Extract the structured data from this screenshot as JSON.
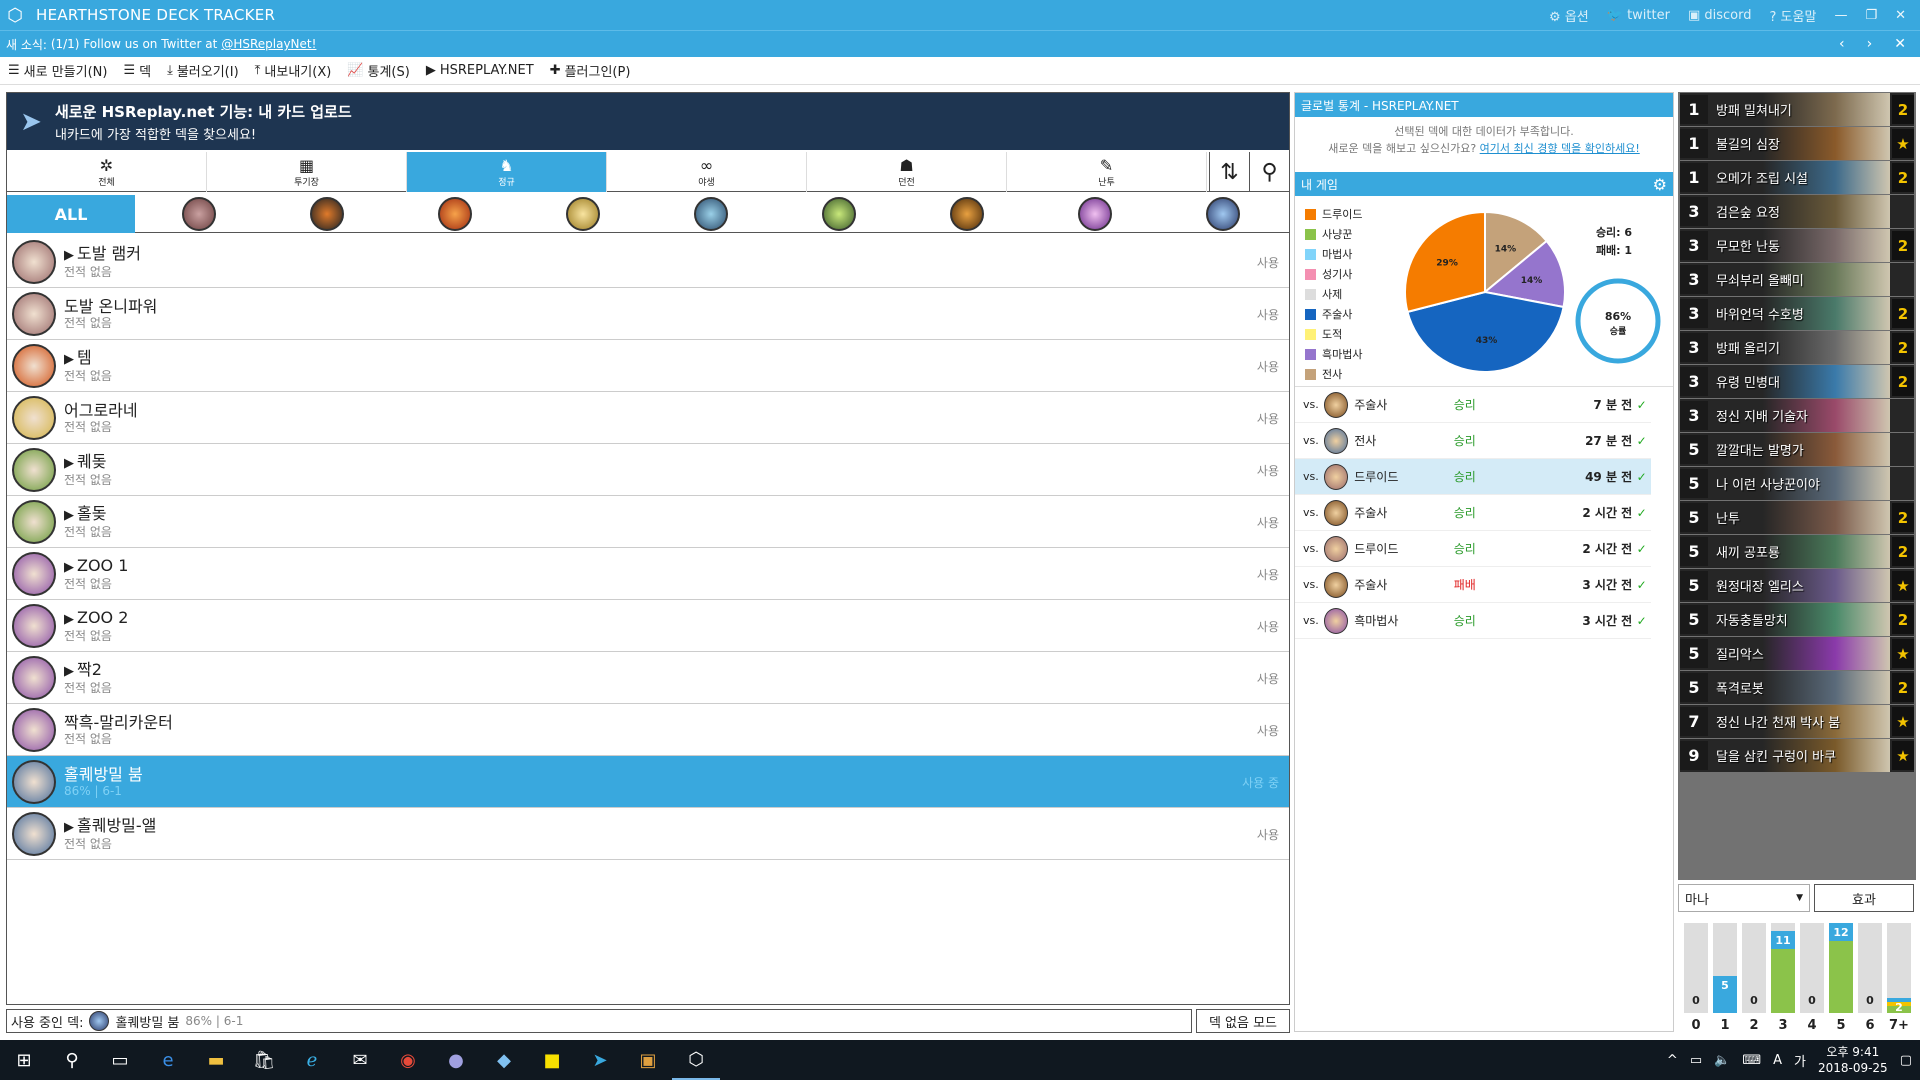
{
  "titlebar": {
    "title": "HEARTHSTONE DECK TRACKER",
    "options": "옵션",
    "twitter": "twitter",
    "discord": "discord",
    "help": "도움말"
  },
  "news": {
    "label": "새 소식:",
    "count": "(1/1)",
    "text": "Follow us on Twitter at",
    "link": "@HSReplayNet!"
  },
  "menu": {
    "new": "새로 만들기(N)",
    "deck": "덱",
    "import": "불러오기(I)",
    "export": "내보내기(X)",
    "stats": "통계(S)",
    "hsreplay": "HSREPLAY.NET",
    "plugins": "플러그인(P)"
  },
  "banner": {
    "title": "새로운 HSReplay.net 기능: 내 카드 업로드",
    "subtitle": "내카드에 가장 적합한 덱을 찾으세요!"
  },
  "modetabs": [
    {
      "label": "전체",
      "icon": "gear-icon"
    },
    {
      "label": "투기장",
      "icon": "arena-icon"
    },
    {
      "label": "정규",
      "icon": "standard-icon"
    },
    {
      "label": "야생",
      "icon": "wild-icon"
    },
    {
      "label": "던전",
      "icon": "dungeon-icon"
    },
    {
      "label": "난투",
      "icon": "brawl-icon"
    }
  ],
  "classtabs": {
    "all": "ALL"
  },
  "decks": [
    {
      "name": "도발 램커",
      "sub": "전적 없음",
      "use": "사용",
      "hs": true,
      "color": "#9a6b6b"
    },
    {
      "name": "도발 온니파워",
      "sub": "전적 없음",
      "use": "사용",
      "hs": false,
      "color": "#9a6b6b"
    },
    {
      "name": "템",
      "sub": "전적 없음",
      "use": "사용",
      "hs": true,
      "color": "#d2551b"
    },
    {
      "name": "어그로라네",
      "sub": "전적 없음",
      "use": "사용",
      "hs": false,
      "color": "#d4b448"
    },
    {
      "name": "퀘돚",
      "sub": "전적 없음",
      "use": "사용",
      "hs": true,
      "color": "#6a9b3a"
    },
    {
      "name": "홀돚",
      "sub": "전적 없음",
      "use": "사용",
      "hs": true,
      "color": "#6a9b3a"
    },
    {
      "name": "ZOO 1",
      "sub": "전적 없음",
      "use": "사용",
      "hs": true,
      "color": "#8b4fa6"
    },
    {
      "name": "ZOO 2",
      "sub": "전적 없음",
      "use": "사용",
      "hs": true,
      "color": "#8b4fa6"
    },
    {
      "name": "짝2",
      "sub": "전적 없음",
      "use": "사용",
      "hs": true,
      "color": "#8b4fa6"
    },
    {
      "name": "짝흑-말리카운터",
      "sub": "전적 없음",
      "use": "사용",
      "hs": false,
      "color": "#8b4fa6"
    },
    {
      "name": "홀퀘방밀 붐",
      "sub": "86% | 6-1",
      "use": "사용 중",
      "hs": false,
      "color": "#4c6f9c",
      "selected": true
    },
    {
      "name": "홀퀘방밀-앨",
      "sub": "전적 없음",
      "use": "사용",
      "hs": true,
      "color": "#4c6f9c"
    }
  ],
  "status": {
    "label": "사용 중인 덱:",
    "deck": "홀퀘방밀 붐",
    "record": "86% | 6-1",
    "nodeck": "덱 없음 모드"
  },
  "global": {
    "header": "글로벌 통계 - HSREPLAY.NET",
    "line1": "선택된 덱에 대한 데이터가 부족합니다.",
    "line2": "새로운 덱을 해보고 싶으신가요?",
    "link": "여기서 최신 경향 덱을 확인하세요!"
  },
  "mygame": {
    "header": "내 게임",
    "wins": "승리: 6",
    "losses": "패배: 1",
    "winrate": "86%",
    "winlabel": "승률"
  },
  "legend": [
    {
      "name": "드루이드",
      "color": "#f57c00"
    },
    {
      "name": "사냥꾼",
      "color": "#8bc34a"
    },
    {
      "name": "마법사",
      "color": "#81d4fa"
    },
    {
      "name": "성기사",
      "color": "#f48fb1"
    },
    {
      "name": "사제",
      "color": "#dddddd"
    },
    {
      "name": "주술사",
      "color": "#1565c0"
    },
    {
      "name": "도적",
      "color": "#fff176"
    },
    {
      "name": "흑마법사",
      "color": "#9575cd"
    },
    {
      "name": "전사",
      "color": "#c4a27a"
    }
  ],
  "chart_data": {
    "type": "pie",
    "slices": [
      {
        "label": "드루이드",
        "value": 29
      },
      {
        "label": "주술사",
        "value": 43
      },
      {
        "label": "흑마법사",
        "value": 14
      },
      {
        "label": "전사",
        "value": 14
      }
    ]
  },
  "games": [
    {
      "vs": "vs.",
      "class": "주술사",
      "result": "승리",
      "time": "7 분 전",
      "color": "#7a4b1e",
      "win": true
    },
    {
      "vs": "vs.",
      "class": "전사",
      "result": "승리",
      "time": "27 분 전",
      "color": "#4c6f9c",
      "win": true
    },
    {
      "vs": "vs.",
      "class": "드루이드",
      "result": "승리",
      "time": "49 분 전",
      "color": "#9a6b6b",
      "win": true,
      "selected": true
    },
    {
      "vs": "vs.",
      "class": "주술사",
      "result": "승리",
      "time": "2 시간 전",
      "color": "#7a4b1e",
      "win": true
    },
    {
      "vs": "vs.",
      "class": "드루이드",
      "result": "승리",
      "time": "2 시간 전",
      "color": "#9a6b6b",
      "win": true
    },
    {
      "vs": "vs.",
      "class": "주술사",
      "result": "패배",
      "time": "3 시간 전",
      "color": "#7a4b1e",
      "win": false
    },
    {
      "vs": "vs.",
      "class": "흑마법사",
      "result": "승리",
      "time": "3 시간 전",
      "color": "#8b4fa6",
      "win": true
    }
  ],
  "cards": [
    {
      "cost": "1",
      "name": "방패 밀쳐내기",
      "count": "2",
      "color": "#7d6a4e"
    },
    {
      "cost": "1",
      "name": "불길의 심장",
      "count": "★",
      "color": "#8a5a2a"
    },
    {
      "cost": "1",
      "name": "오메가 조립 시설",
      "count": "2",
      "color": "#3d6a8a"
    },
    {
      "cost": "3",
      "name": "검은숲 요정",
      "count": "",
      "color": "#6a5a3a"
    },
    {
      "cost": "3",
      "name": "무모한 난동",
      "count": "2",
      "color": "#7a6a6a"
    },
    {
      "cost": "3",
      "name": "무쇠부리 올빼미",
      "count": "",
      "color": "#6a7a5a"
    },
    {
      "cost": "3",
      "name": "바위언덕 수호병",
      "count": "2",
      "color": "#4a7a6a"
    },
    {
      "cost": "3",
      "name": "방패 올리기",
      "count": "2",
      "color": "#6a6a6a"
    },
    {
      "cost": "3",
      "name": "유령 민병대",
      "count": "2",
      "color": "#3a7aaa"
    },
    {
      "cost": "3",
      "name": "정신 지배 기술자",
      "count": "",
      "color": "#9a4a6a"
    },
    {
      "cost": "5",
      "name": "깔깔대는 발명가",
      "count": "",
      "color": "#8a5a3a"
    },
    {
      "cost": "5",
      "name": "나 이런 사냥꾼이야",
      "count": "",
      "color": "#5a6a7a"
    },
    {
      "cost": "5",
      "name": "난투",
      "count": "2",
      "color": "#7a5a4a"
    },
    {
      "cost": "5",
      "name": "새끼 공포룡",
      "count": "2",
      "color": "#4a7a5a"
    },
    {
      "cost": "5",
      "name": "원정대장 엘리스",
      "count": "★",
      "color": "#6a5a8a"
    },
    {
      "cost": "5",
      "name": "자동충돌망치",
      "count": "2",
      "color": "#4a8a6a"
    },
    {
      "cost": "5",
      "name": "질리악스",
      "count": "★",
      "color": "#8a3aaa"
    },
    {
      "cost": "5",
      "name": "폭격로봇",
      "count": "2",
      "color": "#5a6a7a"
    },
    {
      "cost": "7",
      "name": "정신 나간 천재 박사 붐",
      "count": "★",
      "color": "#8a6a3a"
    },
    {
      "cost": "9",
      "name": "달을 삼킨 구렁이 바쿠",
      "count": "★",
      "color": "#7a5a2a"
    }
  ],
  "mana": {
    "select": "마나",
    "effect": "효과",
    "labels": [
      "0",
      "1",
      "2",
      "3",
      "4",
      "5",
      "6",
      "7+"
    ],
    "values": [
      0,
      5,
      0,
      11,
      0,
      12,
      0,
      2
    ],
    "max": 12
  },
  "taskbar": {
    "time": "오후 9:41",
    "date": "2018-09-25"
  }
}
